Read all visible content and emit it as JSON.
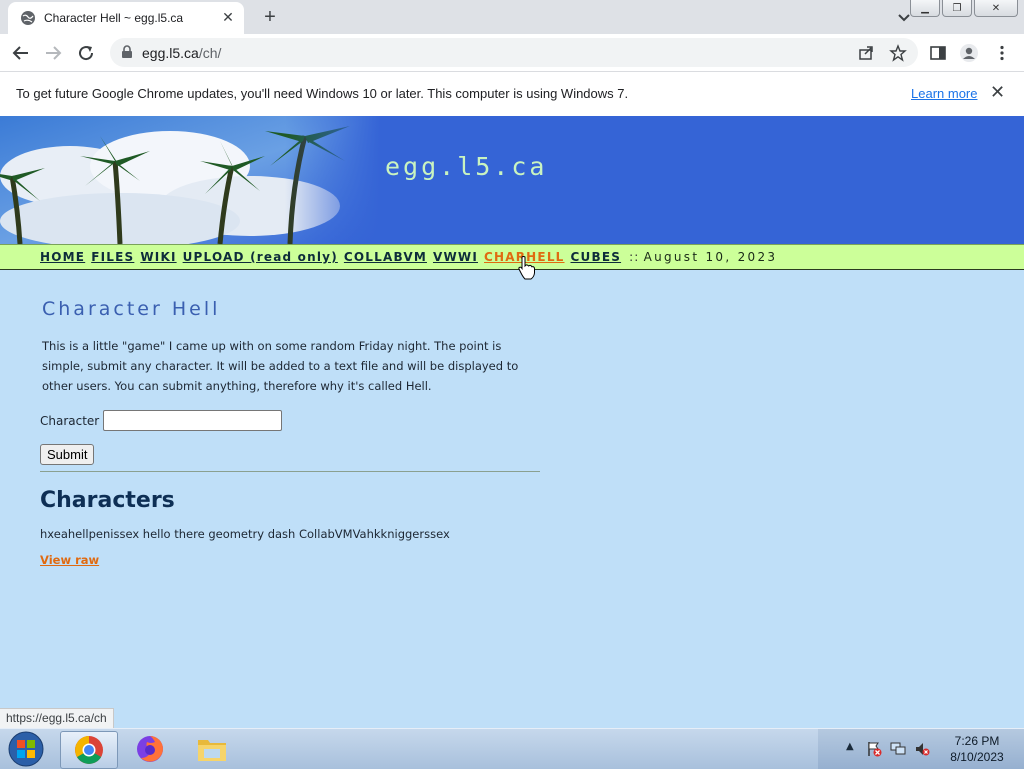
{
  "browser": {
    "tab_title": "Character Hell ~ egg.l5.ca",
    "url_host": "egg.l5.ca",
    "url_path": "/ch/",
    "new_tab_symbol": "+",
    "infobar_message": "To get future Google Chrome updates, you'll need Windows 10 or later. This computer is using Windows 7.",
    "infobar_link": "Learn more",
    "status_url": "https://egg.l5.ca/ch"
  },
  "site": {
    "title": "egg.l5.ca",
    "nav": [
      {
        "label": "HOME"
      },
      {
        "label": "FILES"
      },
      {
        "label": "WIKI"
      },
      {
        "label": "UPLOAD (read only)"
      },
      {
        "label": "COLLABVM"
      },
      {
        "label": "VWWI"
      },
      {
        "label": "CHARHELL"
      },
      {
        "label": "CUBES"
      }
    ],
    "nav_separator": "::",
    "date": "August 10, 2023"
  },
  "page": {
    "heading": "Character Hell",
    "intro": "This is a little \"game\" I came up with on some random Friday night. The point is simple, submit any character. It will be added to a text file and will be displayed to other users. You can submit anything, therefore why it's called Hell.",
    "character_label": "Character",
    "character_value": "",
    "submit_label": "Submit",
    "characters_heading": "Characters",
    "characters_text": "hxeahellpenissex hello there geometry dash CollabVMVahkkniggerssex",
    "view_raw": "View raw"
  },
  "taskbar": {
    "time": "7:26 PM",
    "date": "8/10/2023",
    "tray_caret": "▲"
  },
  "colors": {
    "page_bg": "#bfdff8",
    "banner_bg": "#3564d6",
    "nav_bg": "#ccff99",
    "active_link": "#e06a10",
    "heading": "#3a5fb0"
  }
}
